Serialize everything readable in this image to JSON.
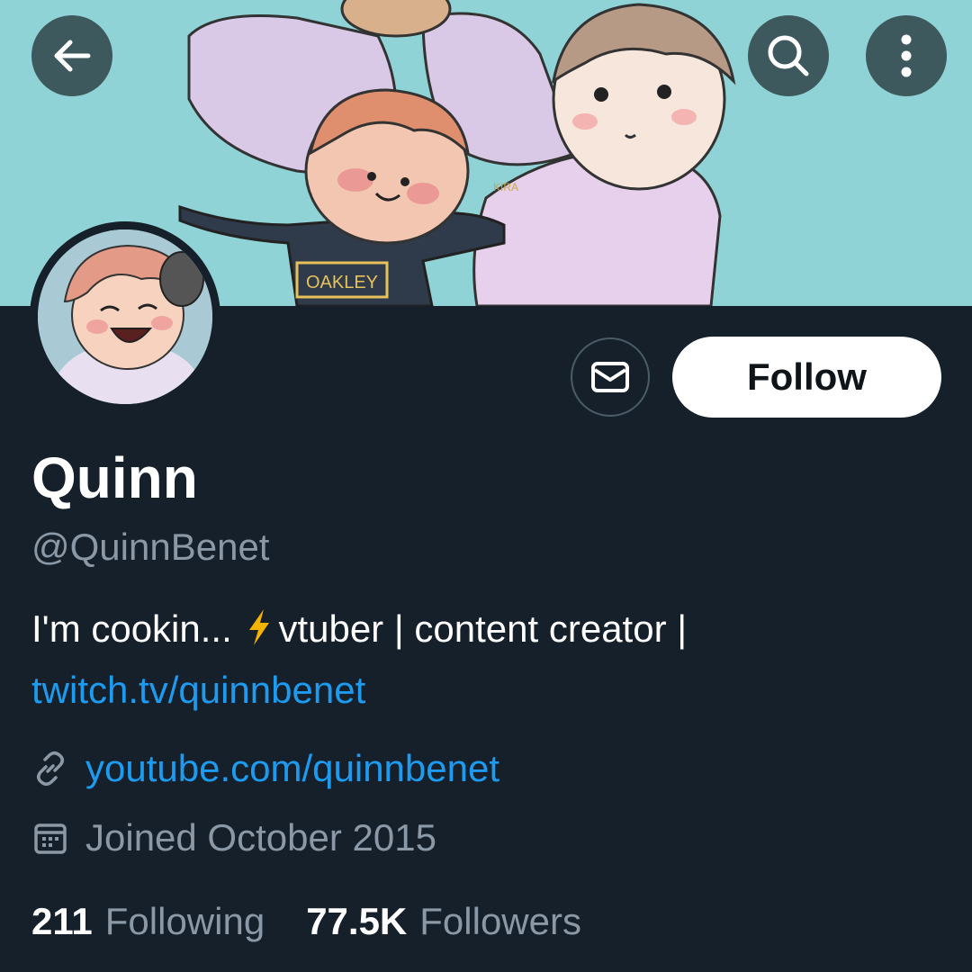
{
  "banner": {
    "shirt_text": "OAKLEY",
    "artist_mark": "KIRA"
  },
  "profile": {
    "name": "Quinn",
    "handle": "@QuinnBenet",
    "bio_text": "I'm cookin... ",
    "bio_text_after_bolt": "vtuber | content creator |",
    "bio_link": "twitch.tv/quinnbenet",
    "website": "youtube.com/quinnbenet",
    "joined": "Joined October 2015"
  },
  "actions": {
    "follow_label": "Follow"
  },
  "stats": {
    "following_count": "211",
    "following_label": "Following",
    "followers_count": "77.5K",
    "followers_label": "Followers"
  },
  "icons": {
    "back": "arrow-left-icon",
    "search": "search-icon",
    "more": "more-vertical-icon",
    "message": "envelope-icon",
    "link": "link-icon",
    "calendar": "calendar-icon",
    "bolt": "lightning-bolt-emoji"
  },
  "colors": {
    "background": "#15202b",
    "link": "#1d9bf0",
    "secondary_text": "#8b98a5",
    "banner_bg": "#8fd3d6",
    "bolt": "#f4b400"
  }
}
